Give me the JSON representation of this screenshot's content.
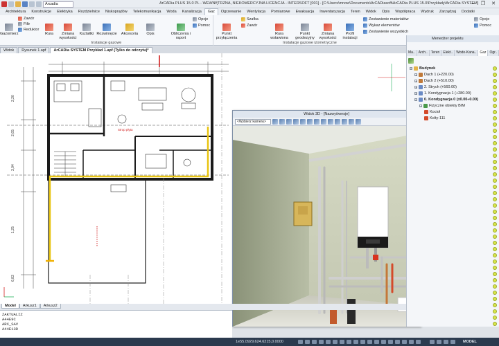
{
  "app": {
    "title": "ArCADia PLUS 15.0 PL - WEWNĘTRZNA, NIEKOMERCYJNA LICENCJA - INTERSOFT [001] - [C:\\Users\\mnow\\Documents\\ArCADiasoft\\ArCADia PLUS 15.0\\Przykłady\\ArCADia SYSTEM]",
    "qat_combo": "Arcadia",
    "window_controls": [
      "—",
      "❐",
      "✕"
    ]
  },
  "ribbon": {
    "tabs": [
      "Architektura",
      "Konstrukcje",
      "Elektryka",
      "Rozdzielnice",
      "Niskoprądów",
      "Telekomunikacja",
      "Woda",
      "Kanalizacja",
      "Gaz",
      "Ogrzewanie",
      "Wentylacja",
      "Pomiarowe",
      "Ewakuacja",
      "Inwentaryzacja",
      "Teren",
      "Widok",
      "Opis",
      "Współpraca",
      "Wydruk",
      "Zarządzaj",
      "Dodatki"
    ],
    "active_tab": "Gaz",
    "groups": {
      "gas_install_label": "Instalacje gazowe",
      "iso_install_label": "Instalacje gazowe izometryczne"
    },
    "small_left": [
      "Zawór",
      "Filtr",
      "Reduktor"
    ],
    "buttons_a": [
      "Gazomierz",
      "Rura",
      "Zmiana wysokości",
      "Kształtki",
      "Rozwinięcie",
      "Akcesoria"
    ],
    "buttons_a2": [
      "Punkt przyłączenia",
      "Szafka"
    ],
    "buttons_b": [
      "Opis",
      "Obliczenia i raport"
    ],
    "small_mid": [
      "Opcje",
      "Pomoc"
    ],
    "small_mid2": [
      "Zawór"
    ],
    "buttons_c": [
      "Rura wstawiona",
      "Punkt geodezyjny",
      "Zmiana wysokości",
      "Profil instalacji"
    ],
    "small_right": [
      "Zestawienie materiałów",
      "Wykaz elementów",
      "Zestawienie wszystkich"
    ],
    "small_right2": [
      "Opcje",
      "Pomoc"
    ]
  },
  "doctabs": [
    "Widok",
    "Rysunek 1.apf",
    "ArCADia SYSTEM Przykład 1.apf (Tylko do odczytu)*"
  ],
  "active_doctab": "ArCADia SYSTEM Przykład 1.apf (Tylko do odczytu)*",
  "drawing": {
    "red_label_1": "Strop płyta",
    "red_label_2": "",
    "dimensions_left": [
      "2,20",
      "2,65",
      "3,04",
      "1,25",
      "6,83"
    ]
  },
  "win3d": {
    "title": "Widok 3D - [Nazwy/wersje]",
    "camera": "<Wybierz kamerę>"
  },
  "pm": {
    "title": "Menedżer projektu",
    "tabs": [
      "Ma..",
      "Arch..",
      "Teren",
      "Elekt..",
      "Wodo-Kana..",
      "Gaz",
      "Ogr..",
      "Wen..",
      "Pom.."
    ],
    "active_tab": "Gaz",
    "tree": [
      {
        "label": "Budynek",
        "level": 0,
        "bold": true,
        "exp": "−"
      },
      {
        "label": "Dach 1 (+220.00)",
        "level": 1,
        "bold": false,
        "exp": "+"
      },
      {
        "label": "Dach 2 (+510.00)",
        "level": 1,
        "bold": false,
        "exp": "+"
      },
      {
        "label": "2. Strych (+560.00)",
        "level": 1,
        "bold": false,
        "exp": "+"
      },
      {
        "label": "1. Kondygnacja 1 (+280.00)",
        "level": 1,
        "bold": false,
        "exp": "+"
      },
      {
        "label": "0. Kondygnacja 0 (±0.00÷0.00)",
        "level": 1,
        "bold": true,
        "exp": "−"
      },
      {
        "label": "Fizyczne obiekty BIM",
        "level": 2,
        "bold": false,
        "exp": "−"
      },
      {
        "label": "Kocioł",
        "level": 3,
        "bold": false,
        "exp": ""
      },
      {
        "label": "Kolty-111",
        "level": 3,
        "bold": false,
        "exp": ""
      }
    ]
  },
  "layout_tabs": [
    "Model",
    "Arkusz1",
    "Arkusz2"
  ],
  "active_layout": "Model",
  "cmdline": [
    "ZAKTUALIZ",
    "A44E9C",
    "ARX_SAV",
    "A44E13D"
  ],
  "status": {
    "coords": "1e55.0929,624.6215,0.0000",
    "mode": "MODEL"
  },
  "colors": {
    "accent": "#2b3a4e",
    "gas_line": "#e8c410",
    "wall": "#1a1a1a",
    "dim_red": "#d21f1f"
  }
}
